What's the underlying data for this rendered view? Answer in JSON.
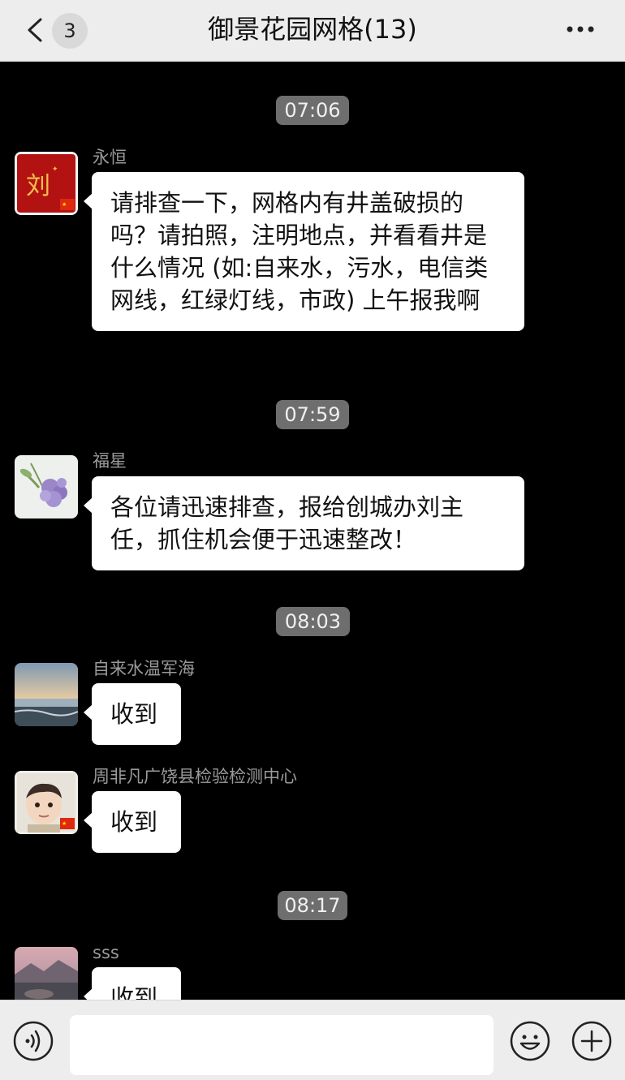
{
  "header": {
    "unread_count": "3",
    "title": "御景花园网格(13)"
  },
  "messages": [
    {
      "type": "time",
      "text": "07:06"
    },
    {
      "type": "msg",
      "sender": "永恒",
      "avatar": "red-calligraphy-avatar",
      "text": "请排查一下，网格内有井盖破损的吗？请拍照，注明地点，并看看井是什么情况 (如:自来水，污水，电信类网线，红绿灯线，市政) 上午报我啊"
    },
    {
      "type": "time",
      "text": "07:59"
    },
    {
      "type": "msg",
      "sender": "福星",
      "avatar": "lilac-flower-avatar",
      "text": "各位请迅速排查，报给创城办刘主任，抓住机会便于迅速整改！"
    },
    {
      "type": "time",
      "text": "08:03"
    },
    {
      "type": "msg",
      "sender": "自来水温军海",
      "avatar": "seascape-avatar",
      "text": "收到"
    },
    {
      "type": "msg",
      "sender": "周非凡广饶县检验检测中心",
      "avatar": "child-photo-avatar",
      "text": "收到"
    },
    {
      "type": "time",
      "text": "08:17"
    },
    {
      "type": "msg",
      "sender": "sss",
      "avatar": "landscape-avatar",
      "text": "收到"
    }
  ],
  "input": {
    "placeholder": "",
    "value": ""
  },
  "icons": {
    "back": "chevron-left-icon",
    "more": "more-dots-icon",
    "voice": "voice-icon",
    "emoji": "emoji-icon",
    "plus": "plus-icon"
  },
  "colors": {
    "header_bg": "#ededed",
    "chat_bg": "#000000",
    "bubble_bg": "#ffffff",
    "timestamp_bg": "#6e6e6e",
    "sender_text": "#9a9a9a"
  }
}
